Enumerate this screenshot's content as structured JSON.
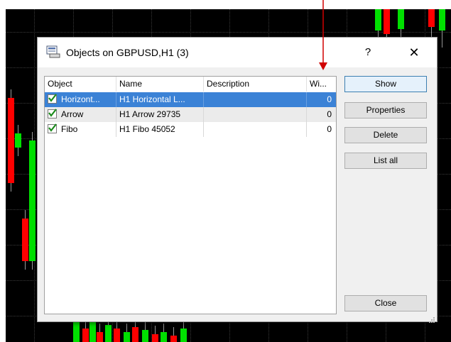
{
  "dialog": {
    "title": "Objects on GBPUSD,H1 (3)",
    "help_label": "?",
    "close_glyph": "✕"
  },
  "table": {
    "columns": [
      "Object",
      "Name",
      "Description",
      "Wi..."
    ],
    "rows": [
      {
        "object": "Horizont...",
        "name": "H1 Horizontal L...",
        "description": "",
        "width": "0",
        "checked": true,
        "selected": true
      },
      {
        "object": "Arrow",
        "name": "H1 Arrow 29735",
        "description": "",
        "width": "0",
        "checked": true,
        "selected": false
      },
      {
        "object": "Fibo",
        "name": "H1 Fibo 45052",
        "description": "",
        "width": "0",
        "checked": true,
        "selected": false
      }
    ]
  },
  "buttons": {
    "show": "Show",
    "properties": "Properties",
    "delete": "Delete",
    "list_all": "List all",
    "close": "Close"
  },
  "colors": {
    "bull_candle": "#00e000",
    "bear_candle": "#ff0000",
    "selection": "#3b82d6",
    "annotation_arrow": "#d00000"
  },
  "icons": {
    "title": "objects-list-icon",
    "checkbox": "checkmark-icon",
    "resize": "resize-grip-icon"
  }
}
